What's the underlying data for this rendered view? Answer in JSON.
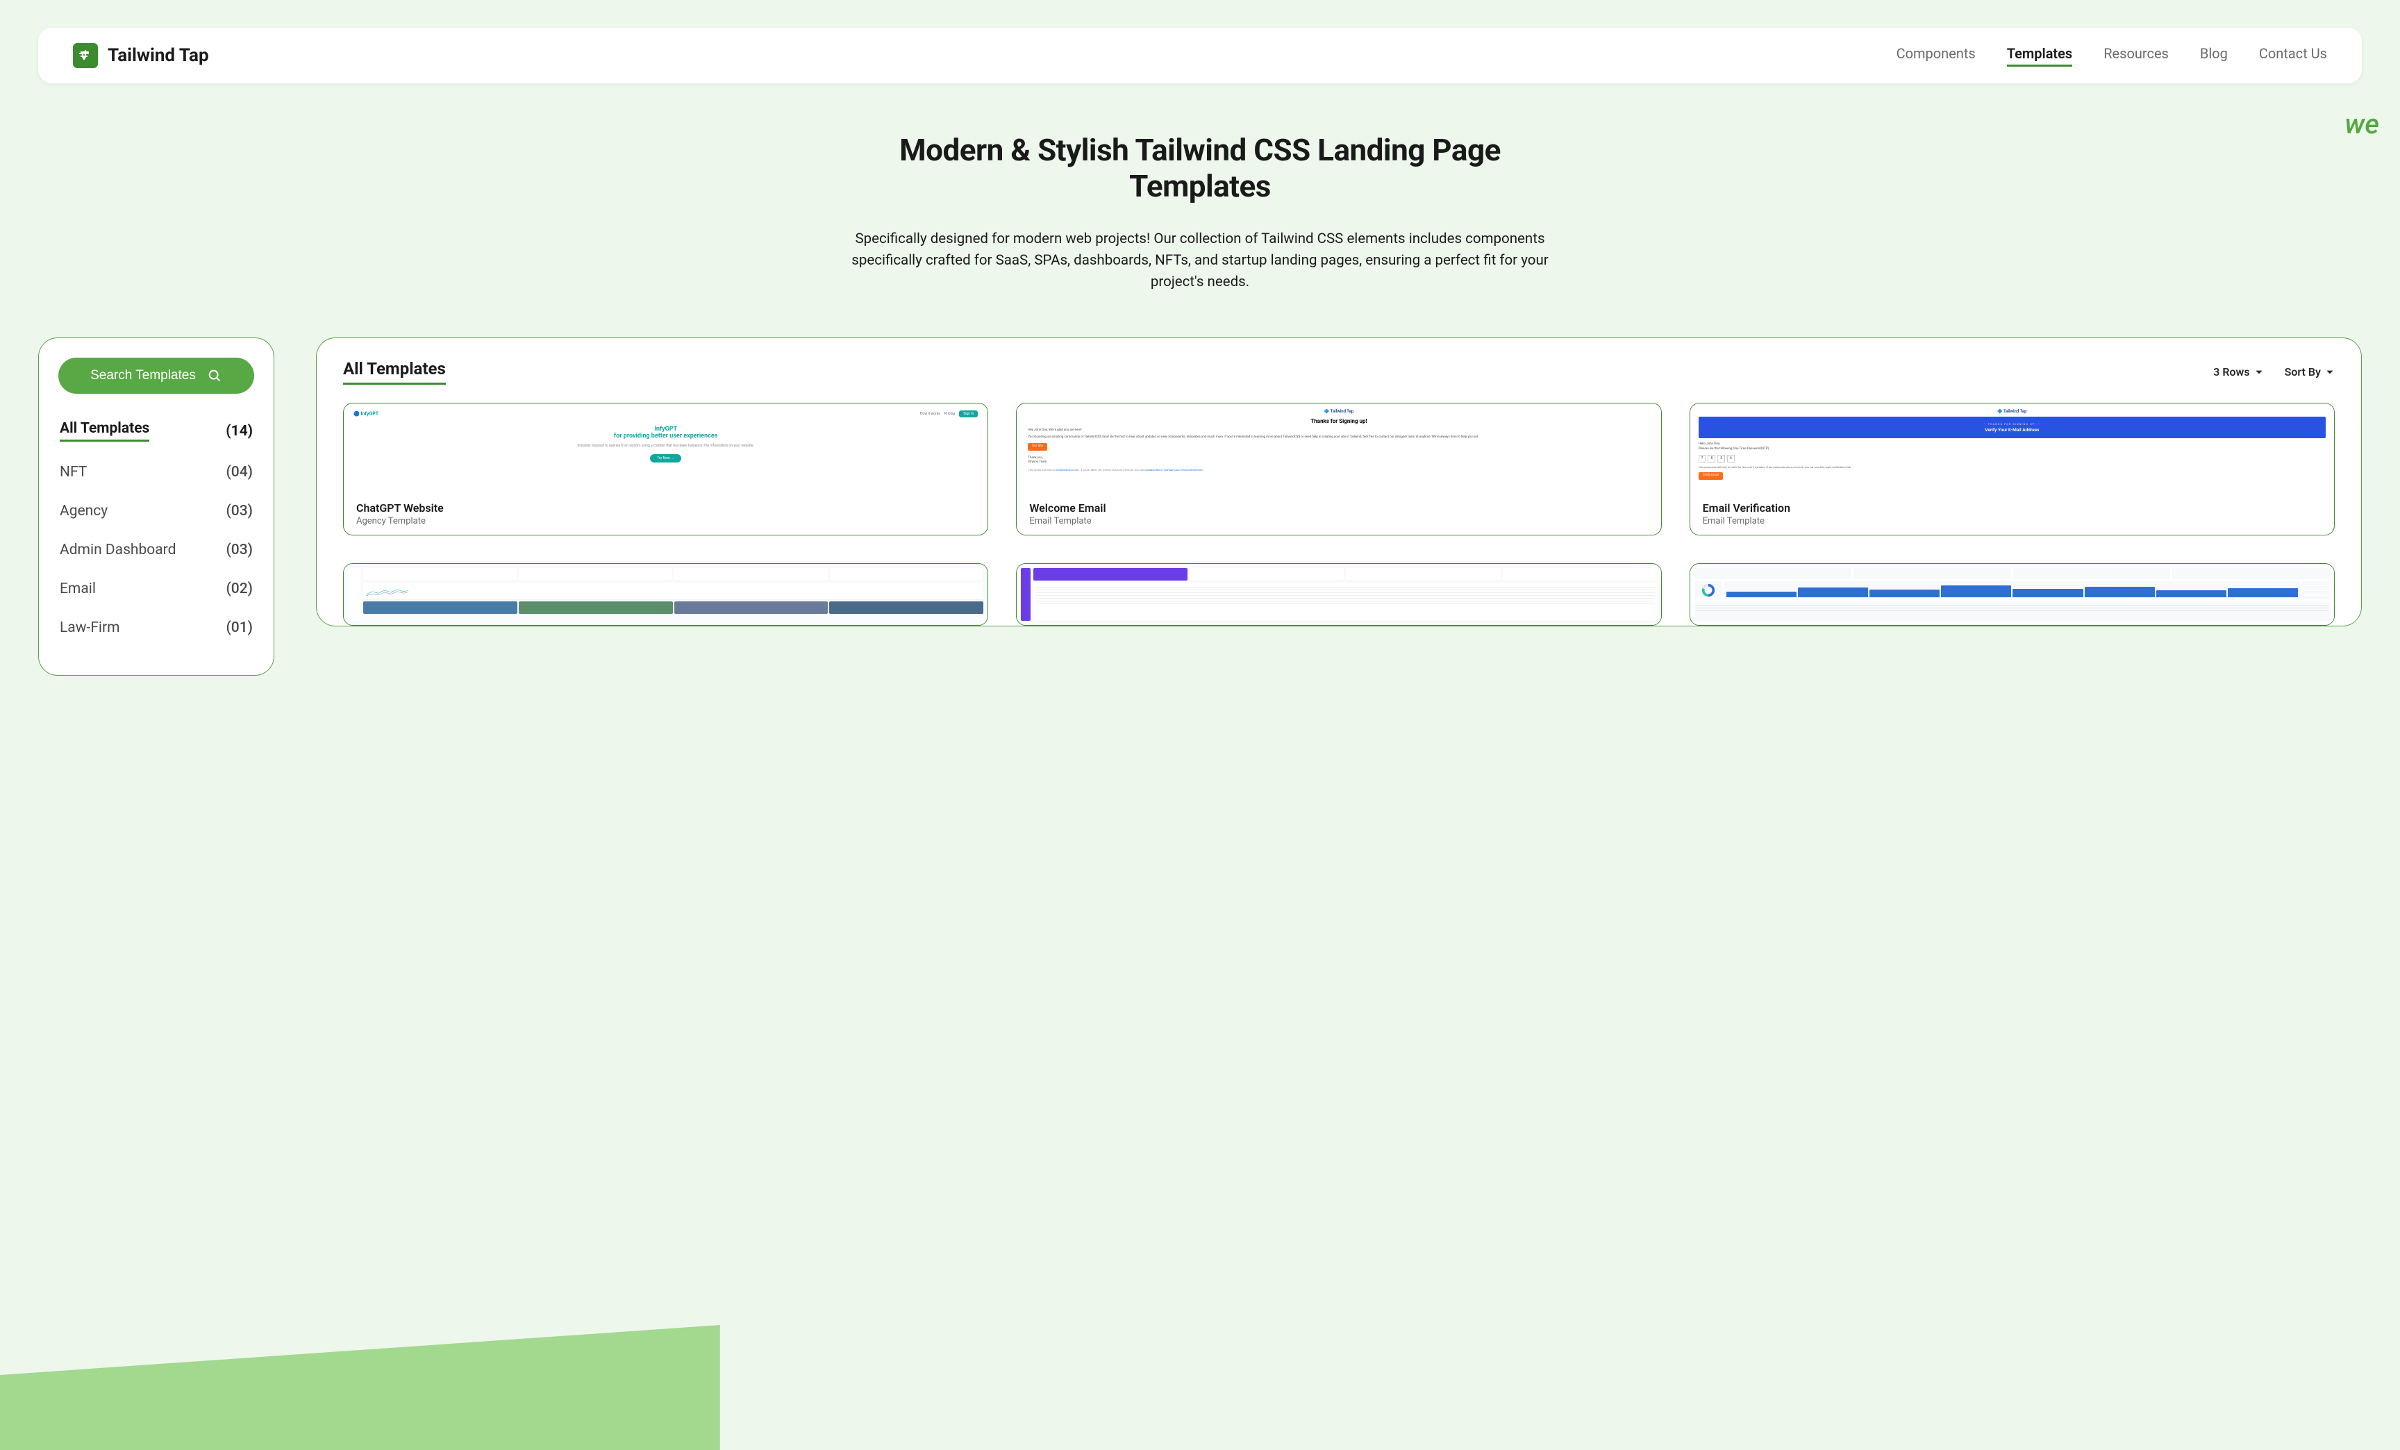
{
  "brand": {
    "name": "Tailwind Tap"
  },
  "nav": {
    "items": [
      {
        "label": "Components",
        "active": false
      },
      {
        "label": "Templates",
        "active": true
      },
      {
        "label": "Resources",
        "active": false
      },
      {
        "label": "Blog",
        "active": false
      },
      {
        "label": "Contact Us",
        "active": false
      }
    ]
  },
  "decorative": "we",
  "hero": {
    "title": "Modern & Stylish Tailwind CSS Landing Page Templates",
    "subtitle": "Specifically designed for modern web projects! Our collection of Tailwind CSS elements includes components specifically crafted for SaaS, SPAs, dashboards, NFTs, and startup landing pages, ensuring a perfect fit for your project's needs."
  },
  "sidebar": {
    "search_label": "Search Templates",
    "categories": [
      {
        "name": "All Templates",
        "count": "(14)",
        "active": true
      },
      {
        "name": "NFT",
        "count": "(04)",
        "active": false
      },
      {
        "name": "Agency",
        "count": "(03)",
        "active": false
      },
      {
        "name": "Admin Dashboard",
        "count": "(03)",
        "active": false
      },
      {
        "name": "Email",
        "count": "(02)",
        "active": false
      },
      {
        "name": "Law-Firm",
        "count": "(01)",
        "active": false
      }
    ]
  },
  "panel": {
    "title": "All Templates",
    "rows_label": "3 Rows",
    "sort_label": "Sort By"
  },
  "templates": [
    {
      "title": "ChatGPT Website",
      "subtitle": "Agency Template",
      "preview_type": "infygpt"
    },
    {
      "title": "Welcome Email",
      "subtitle": "Email Template",
      "preview_type": "welcome"
    },
    {
      "title": "Email Verification",
      "subtitle": "Email Template",
      "preview_type": "verify"
    },
    {
      "title": "",
      "subtitle": "",
      "preview_type": "dash1"
    },
    {
      "title": "",
      "subtitle": "",
      "preview_type": "dash2"
    },
    {
      "title": "",
      "subtitle": "",
      "preview_type": "dash3"
    }
  ],
  "preview_text": {
    "infygpt": {
      "logo": "🔵 InfyGPT",
      "nav1": "How it works",
      "nav2": "Pricing",
      "signin": "Sign In",
      "title_prefix": "Infy",
      "title_accent": "GPT",
      "title_line2": "for providing better user experiences",
      "desc": "Instantly respond to queries from visitors using a chatbot that has been trained on the information on your website.",
      "btn": "Try Now →"
    },
    "welcome": {
      "logo": "🔷 Tailwind Tap",
      "title": "Thanks for Signing up!",
      "greeting": "Hey John Doe, We're glad you are here!",
      "body": "You're joining an amazing community of TailwindCSS fans! Be the first to hear about updates on new components, templates and much more. If you're interested in learning more about TailwindCSS or need help in creating your site in Tailwind, feel free to contact our designer team at anytime. We're always here to help you out.",
      "btn": "Our Site",
      "thanks": "Thank you,",
      "team": "Infynno Team",
      "footer_prefix": "This email was sent to ",
      "footer_email": "test@infynno.com",
      "footer_mid": ". If you'd rather not receive this kind of email, you can ",
      "footer_link": "unsubscribe or manage your email preferences."
    },
    "verify": {
      "logo": "🔷 Tailwind Tap",
      "banner1": "— THANKS FOR SIGNING UP! —",
      "banner2": "Verify Your E-Mail Address",
      "greeting": "Hello John Doe,",
      "body": "Please use the following One Time Password(OTP)",
      "code": [
        "7",
        "8",
        "5",
        "6"
      ],
      "note": "This passcode will only be valid for the next 2 minutes. If the passcode does not work, you can use this login verification link:",
      "btn": "Verify Email"
    }
  }
}
